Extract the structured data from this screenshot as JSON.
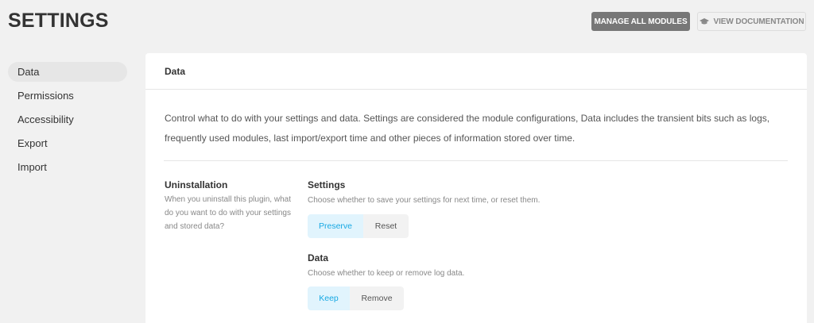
{
  "header": {
    "title": "SETTINGS",
    "manage_label": "MANAGE ALL MODULES",
    "docs_label": "VIEW DOCUMENTATION"
  },
  "sidebar": {
    "items": [
      {
        "label": "Data",
        "active": true
      },
      {
        "label": "Permissions",
        "active": false
      },
      {
        "label": "Accessibility",
        "active": false
      },
      {
        "label": "Export",
        "active": false
      },
      {
        "label": "Import",
        "active": false
      }
    ]
  },
  "panel": {
    "title": "Data",
    "description": "Control what to do with your settings and data. Settings are considered the module configurations, Data includes the transient bits such as logs, frequently used modules, last import/export time and other pieces of information stored over time.",
    "uninstall": {
      "title": "Uninstallation",
      "description": "When you uninstall this plugin, what do you want to do with your settings and stored data?"
    },
    "settings_group": {
      "title": "Settings",
      "description": "Choose whether to save your settings for next time, or reset them.",
      "options": [
        "Preserve",
        "Reset"
      ],
      "selected": "Preserve"
    },
    "data_group": {
      "title": "Data",
      "description": "Choose whether to keep or remove log data.",
      "options": [
        "Keep",
        "Remove"
      ],
      "selected": "Keep"
    }
  },
  "colors": {
    "accent": "#17a8e3",
    "accent_bg": "#e1f4fd",
    "primary_button": "#777777"
  },
  "icons": {
    "docs": "graduation-cap-icon"
  }
}
